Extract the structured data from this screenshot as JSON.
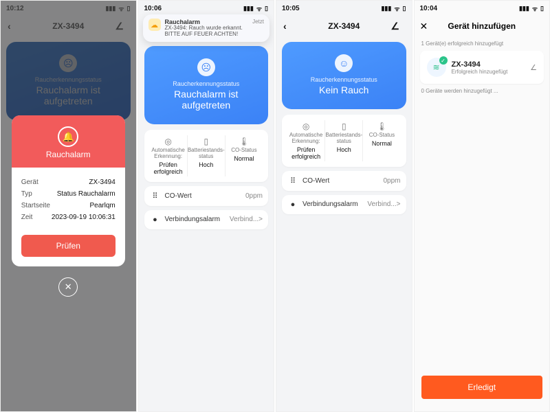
{
  "screens": [
    {
      "statusbar_time": "10:12",
      "title": "ZX-3494",
      "hero_sub": "Raucherkennungsstatus",
      "hero_main": "Rauchalarm ist aufgetreten",
      "modal": {
        "title": "Rauchalarm",
        "rows": [
          {
            "k": "Gerät",
            "v": "ZX-3494"
          },
          {
            "k": "Typ",
            "v": "Status Rauchalarm"
          },
          {
            "k": "Startseite",
            "v": "Pearlqm"
          },
          {
            "k": "Zeit",
            "v": "2023-09-19 10:06:31"
          }
        ],
        "button": "Prüfen"
      }
    },
    {
      "statusbar_time": "10:06",
      "title": "ZX-3494",
      "notification": {
        "title": "Rauchalarm",
        "body": "ZX-3494: Rauch wurde erkannt. BITTE AUF FEUER ACHTEN!",
        "time": "Jetzt"
      },
      "hero_sub": "Raucherkennungsstatus",
      "hero_main": "Rauchalarm ist aufgetreten",
      "stats": [
        {
          "label": "Automatische Erkennung:",
          "value": "Prüfen erfolgreich"
        },
        {
          "label": "Batteriestands-status",
          "value": "Hoch"
        },
        {
          "label": "CO-Status",
          "value": "Normal"
        }
      ],
      "co_label": "CO-Wert",
      "co_value": "0ppm",
      "link_label": "Verbindungsalarm",
      "link_value": "Verbind...>"
    },
    {
      "statusbar_time": "10:05",
      "title": "ZX-3494",
      "hero_sub": "Raucherkennungsstatus",
      "hero_main": "Kein Rauch",
      "stats": [
        {
          "label": "Automatische Erkennung:",
          "value": "Prüfen erfolgreich"
        },
        {
          "label": "Batteriestands-status",
          "value": "Hoch"
        },
        {
          "label": "CO-Status",
          "value": "Normal"
        }
      ],
      "co_label": "CO-Wert",
      "co_value": "0ppm",
      "link_label": "Verbindungsalarm",
      "link_value": "Verbind...>"
    },
    {
      "statusbar_time": "10:04",
      "title": "Gerät hinzufügen",
      "success_count": "1 Gerät(e) erfolgreich hinzugefügt",
      "device_name": "ZX-3494",
      "device_status": "Erfolgreich hinzugefügt",
      "pending": "0 Geräte werden hinzugefügt ...",
      "done": "Erledigt"
    }
  ]
}
